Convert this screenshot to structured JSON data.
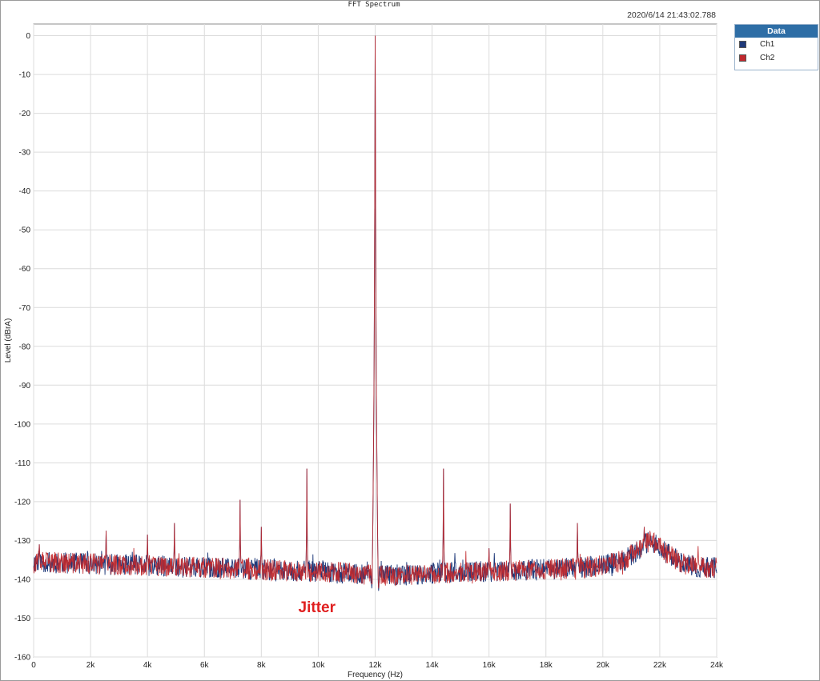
{
  "chart_data": {
    "type": "line",
    "title": "FFT Spectrum",
    "timestamp": "2020/6/14 21:43:02.788",
    "xlabel": "Frequency (Hz)",
    "ylabel": "Level (dBrA)",
    "xlim": [
      0,
      24000
    ],
    "ylim": [
      -160,
      3
    ],
    "x_ticks": [
      0,
      2000,
      4000,
      6000,
      8000,
      10000,
      12000,
      14000,
      16000,
      18000,
      20000,
      22000,
      24000
    ],
    "x_tick_labels": [
      "0",
      "2k",
      "4k",
      "6k",
      "8k",
      "10k",
      "12k",
      "14k",
      "16k",
      "18k",
      "20k",
      "22k",
      "24k"
    ],
    "y_ticks": [
      0,
      -10,
      -20,
      -30,
      -40,
      -50,
      -60,
      -70,
      -80,
      -90,
      -100,
      -110,
      -120,
      -130,
      -140,
      -150,
      -160
    ],
    "y_tick_labels": [
      "0",
      "-10",
      "-20",
      "-30",
      "-40",
      "-50",
      "-60",
      "-70",
      "-80",
      "-90",
      "-100",
      "-110",
      "-120",
      "-130",
      "-140",
      "-150",
      "-160"
    ],
    "grid": true,
    "legend_position": "top-right-outside",
    "legend_title": "Data",
    "series": [
      {
        "name": "Ch1",
        "color": "#1f3a7a"
      },
      {
        "name": "Ch2",
        "color": "#c0282d"
      }
    ],
    "noise_floor": {
      "x": [
        0,
        2000,
        4000,
        6000,
        8000,
        10000,
        11000,
        12500,
        14000,
        16000,
        18000,
        20000,
        20800,
        21300,
        21700,
        22200,
        22800,
        23500,
        24000
      ],
      "y": [
        -135.5,
        -136,
        -136.5,
        -137,
        -137.5,
        -138,
        -138.5,
        -139,
        -138.5,
        -138,
        -137.5,
        -136.5,
        -135,
        -132,
        -130,
        -133,
        -136,
        -137,
        -137
      ]
    },
    "peaks": [
      {
        "x": 12000,
        "y": 0
      },
      {
        "x": 9600,
        "y": -111.5
      },
      {
        "x": 14400,
        "y": -111.5
      },
      {
        "x": 7250,
        "y": -119.5
      },
      {
        "x": 16750,
        "y": -120.5
      },
      {
        "x": 2550,
        "y": -127.5
      },
      {
        "x": 4950,
        "y": -125.5
      },
      {
        "x": 8000,
        "y": -126.5
      },
      {
        "x": 4000,
        "y": -128.5
      },
      {
        "x": 19100,
        "y": -125.5
      },
      {
        "x": 16000,
        "y": -132
      },
      {
        "x": 200,
        "y": -131
      },
      {
        "x": 21450,
        "y": -126.5
      }
    ],
    "annotations": [
      {
        "text": "Jitter",
        "x": 9300,
        "y": -148.5,
        "color": "#e02020"
      }
    ]
  }
}
